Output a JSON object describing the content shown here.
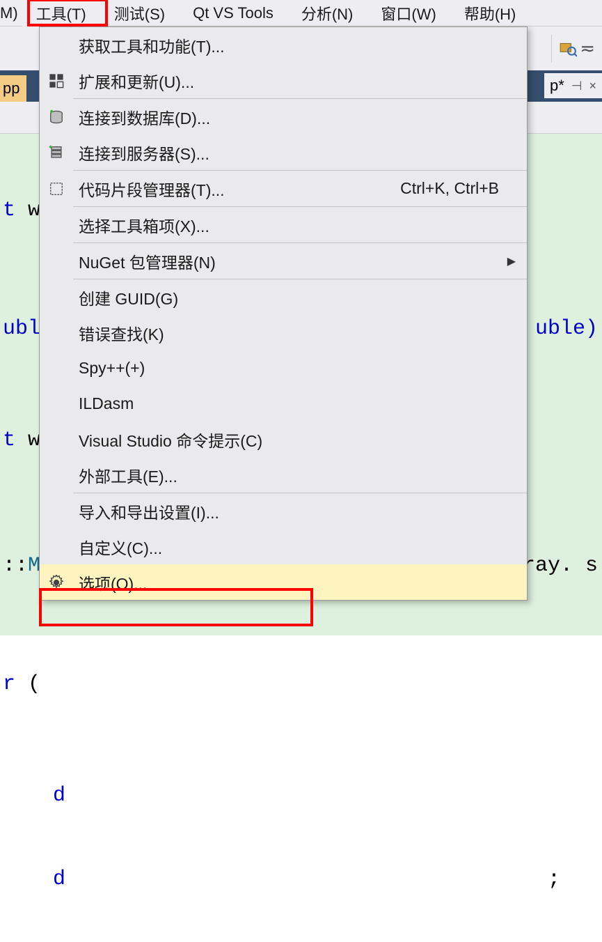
{
  "menubar": {
    "partial_left": "M)",
    "items": [
      "工具(T)",
      "测试(S)",
      "Qt VS Tools",
      "分析(N)",
      "窗口(W)",
      "帮助(H)"
    ]
  },
  "toolbar": {
    "search_icon": "search-icon",
    "trail": "≂"
  },
  "tabs": {
    "left_partial": "pp",
    "right_partial": "p*",
    "pin_glyph": "⊣",
    "close_glyph": "×"
  },
  "editor": {
    "line1_prefix": "t ",
    "line1_ident": "w",
    "line2_prefix": "ubl",
    "line2_right": "uble)",
    "line3_prefix": "t ",
    "line3_ident": "w",
    "line4_prefix": "::",
    "line4_ident": "M",
    "line4_right": "ray. s",
    "line5_prefix": "r ",
    "line5_paren": "(",
    "line6_indent": "    ",
    "line6_ident": "d",
    "line7_indent": "    ",
    "line7_ident": "d",
    "line7_right": ";"
  },
  "dropdown": {
    "items": [
      {
        "icon": "",
        "label": "获取工具和功能(T)...",
        "shortcut": "",
        "submenu": false
      },
      {
        "icon": "extensions",
        "label": "扩展和更新(U)...",
        "shortcut": "",
        "submenu": false
      },
      {
        "sep": true
      },
      {
        "icon": "database",
        "label": "连接到数据库(D)...",
        "shortcut": "",
        "submenu": false
      },
      {
        "icon": "server",
        "label": "连接到服务器(S)...",
        "shortcut": "",
        "submenu": false
      },
      {
        "sep": true
      },
      {
        "icon": "snippet",
        "label": "代码片段管理器(T)...",
        "shortcut": "Ctrl+K, Ctrl+B",
        "submenu": false
      },
      {
        "sep": true
      },
      {
        "icon": "",
        "label": "选择工具箱项(X)...",
        "shortcut": "",
        "submenu": false
      },
      {
        "sep": true
      },
      {
        "icon": "",
        "label": "NuGet 包管理器(N)",
        "shortcut": "",
        "submenu": true
      },
      {
        "sep": true
      },
      {
        "icon": "",
        "label": "创建 GUID(G)",
        "shortcut": "",
        "submenu": false
      },
      {
        "icon": "",
        "label": "错误查找(K)",
        "shortcut": "",
        "submenu": false
      },
      {
        "icon": "",
        "label": "Spy++(+)",
        "shortcut": "",
        "submenu": false
      },
      {
        "icon": "",
        "label": "ILDasm",
        "shortcut": "",
        "submenu": false
      },
      {
        "icon": "",
        "label": "Visual Studio 命令提示(C)",
        "shortcut": "",
        "submenu": false
      },
      {
        "icon": "",
        "label": "外部工具(E)...",
        "shortcut": "",
        "submenu": false
      },
      {
        "sep": true
      },
      {
        "icon": "",
        "label": "导入和导出设置(I)...",
        "shortcut": "",
        "submenu": false
      },
      {
        "icon": "",
        "label": "自定义(C)...",
        "shortcut": "",
        "submenu": false
      },
      {
        "icon": "gear",
        "label": "选项(O)...",
        "shortcut": "",
        "submenu": false,
        "hover": true
      }
    ]
  }
}
